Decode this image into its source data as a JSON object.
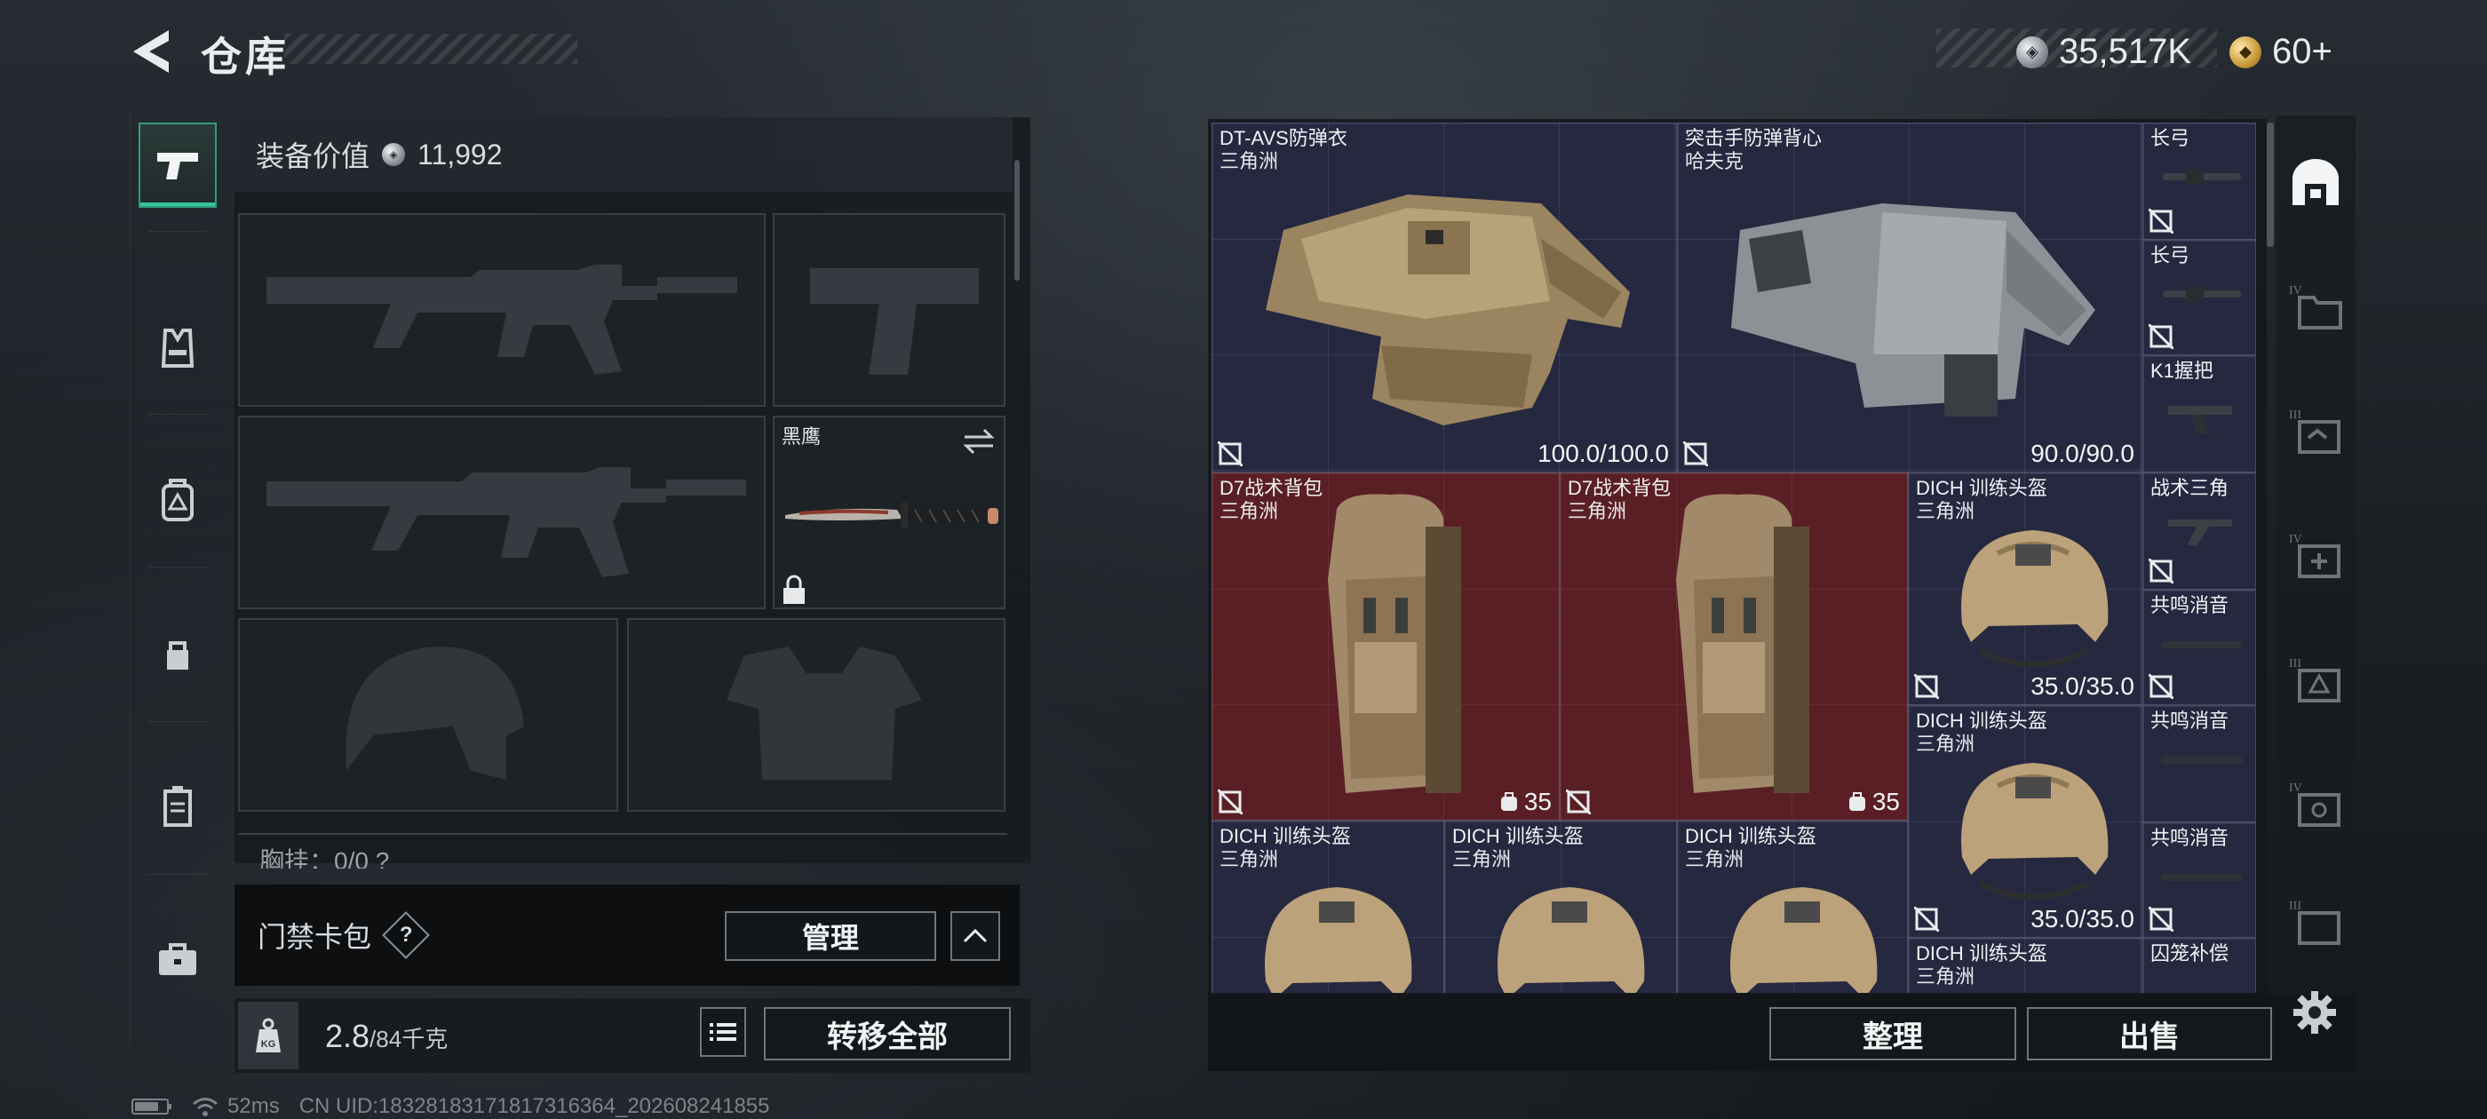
{
  "header": {
    "title": "仓库",
    "silver_amount": "35,517K",
    "gold_amount": "60+"
  },
  "equipment": {
    "value_label": "装备价值",
    "value": "11,992",
    "knife_name": "黑鹰",
    "chest_rig_label": "胸挂：0/0  ?"
  },
  "keycard": {
    "label": "门禁卡包",
    "help": "?",
    "manage_label": "管理"
  },
  "bottom": {
    "weight_current": "2.8",
    "weight_max": "/84千克",
    "transfer_all_label": "转移全部",
    "sort_label": "整理",
    "sell_label": "出售"
  },
  "status": {
    "ping": "52ms",
    "uid": "CN UID:18328183171817316364_202608241855"
  },
  "inventory": {
    "vest1": {
      "name": "DT-AVS防弹衣",
      "region": "三角洲",
      "durability": "100.0/100.0"
    },
    "vest2": {
      "name": "突击手防弹背心",
      "region": "哈夫克",
      "durability": "90.0/90.0"
    },
    "bp1": {
      "name": "D7战术背包",
      "region": "三角洲",
      "capacity": "35"
    },
    "bp2": {
      "name": "D7战术背包",
      "region": "三角洲",
      "capacity": "35"
    },
    "helmet1": {
      "name": "DICH 训练头盔",
      "region": "三角洲",
      "durability": "35.0/35.0"
    },
    "helmet2": {
      "name": "DICH 训练头盔",
      "region": "三角洲",
      "durability": "35.0/35.0"
    },
    "helmet3": {
      "name": "DICH 训练头盔",
      "region": "三角洲"
    },
    "helmet4": {
      "name": "DICH 训练头盔",
      "region": "三角洲"
    },
    "helmet5": {
      "name": "DICH 训练头盔",
      "region": "三角洲"
    },
    "helmet6": {
      "name": "DICH 训练头盔",
      "region": "三角洲"
    },
    "att": [
      {
        "name": "长弓"
      },
      {
        "name": "长弓"
      },
      {
        "name": "K1握把"
      },
      {
        "name": "战术三角"
      },
      {
        "name": "共鸣消音"
      },
      {
        "name": "共鸣消音"
      },
      {
        "name": "共鸣消音"
      },
      {
        "name": "囚笼补偿"
      }
    ]
  },
  "colors": {
    "accent_green": "#36c79d",
    "grid_bg": "#262840",
    "highlight_red": "#5a1f24"
  },
  "icons": [
    "back-arrow-icon",
    "silver-coin-icon",
    "gold-coin-icon",
    "pistol-icon",
    "vest-icon",
    "backpack-icon",
    "pouch-icon",
    "case-icon",
    "briefcase-icon",
    "lock-icon",
    "swap-icon",
    "list-icon",
    "weight-icon",
    "battery-icon",
    "wifi-icon",
    "gear-icon"
  ]
}
